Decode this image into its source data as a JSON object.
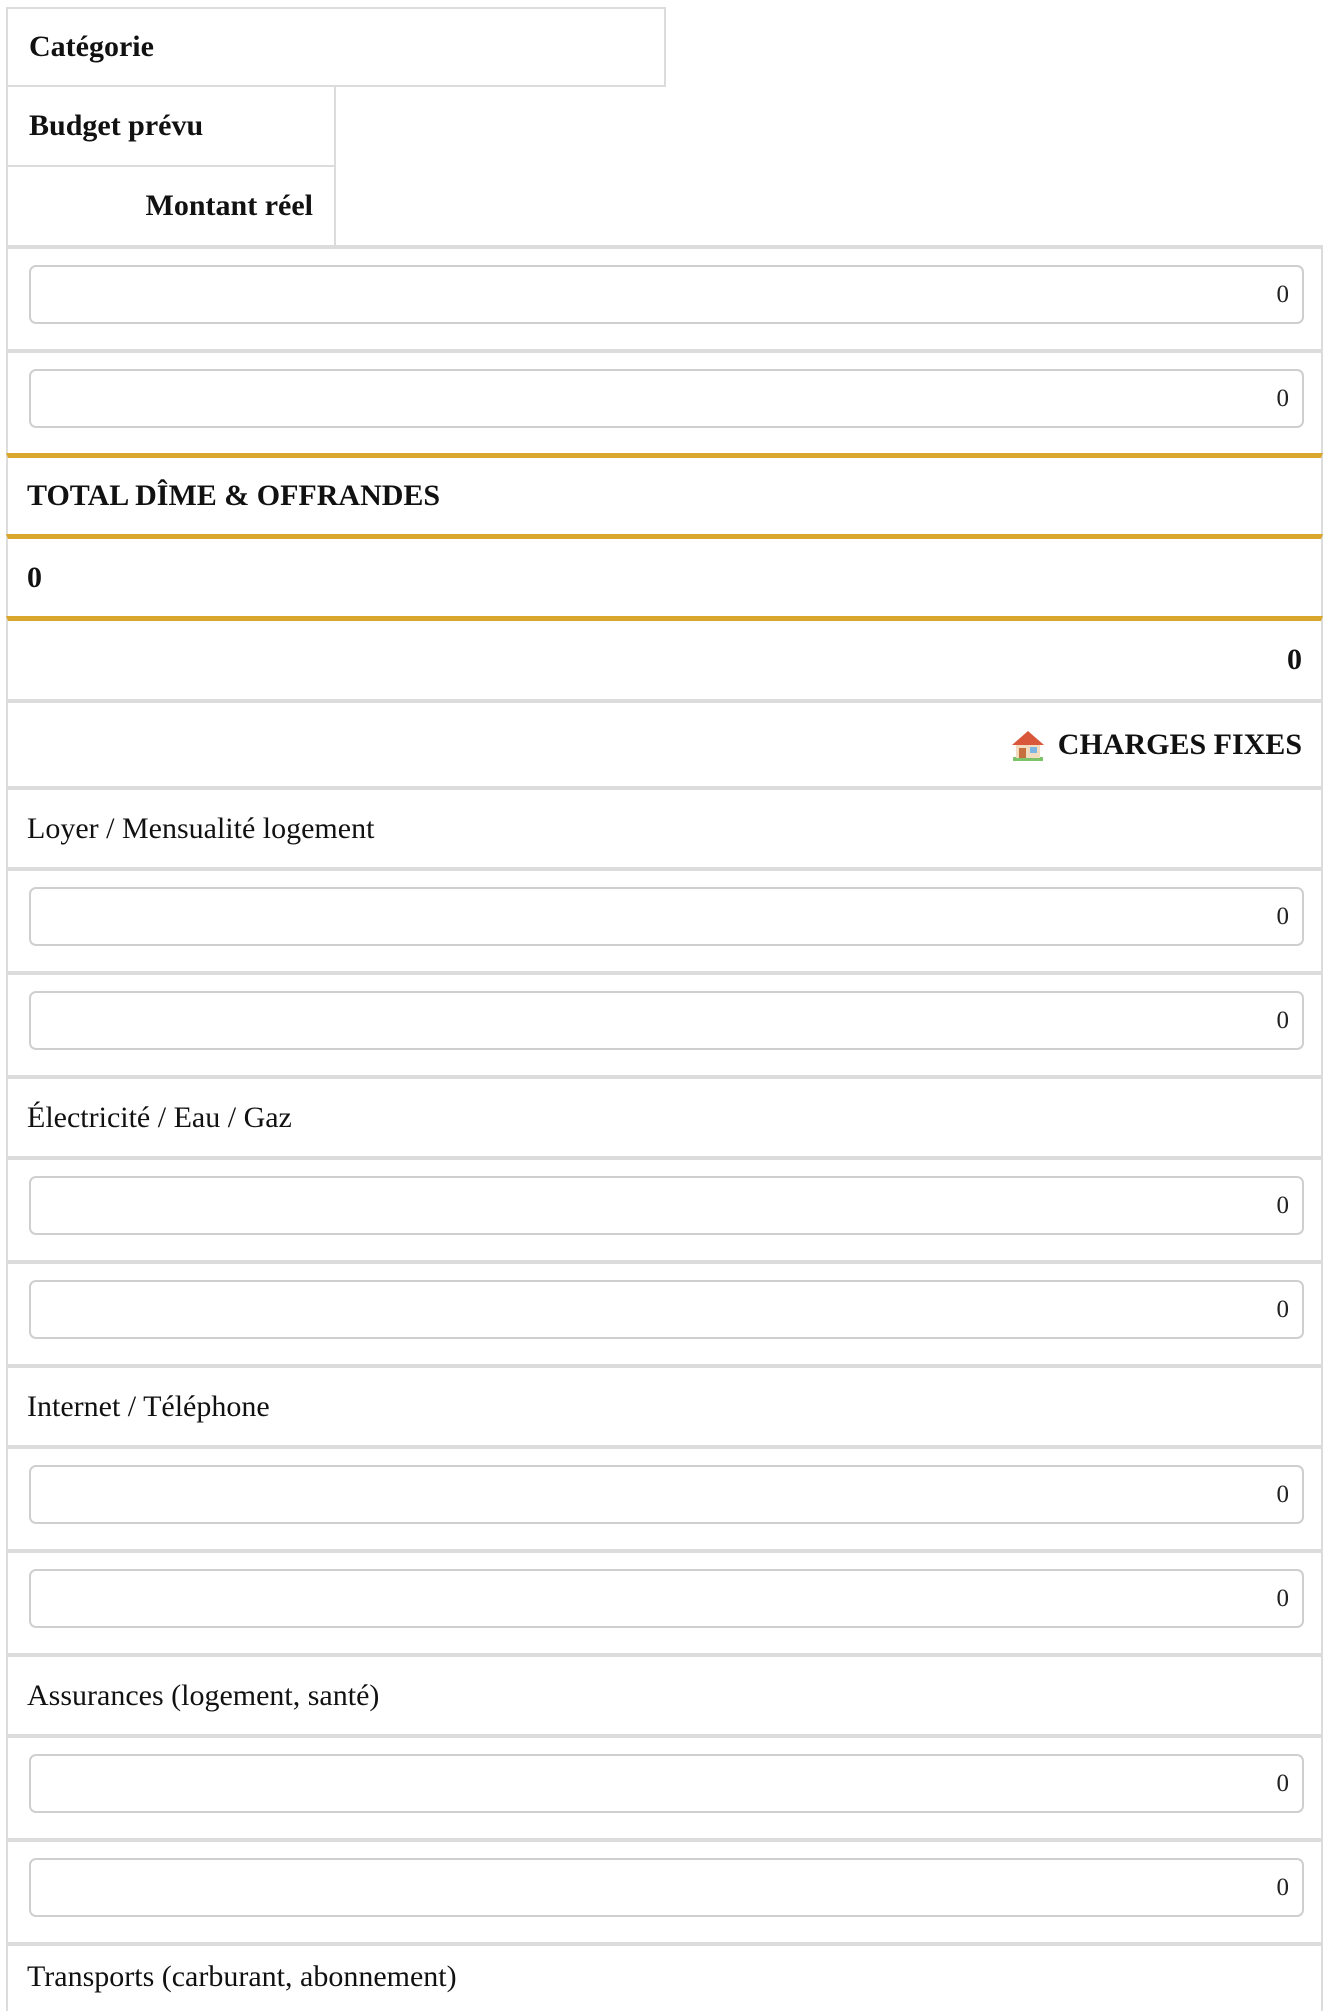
{
  "table": {
    "headers": {
      "category": "Catégorie",
      "planned": "Budget prévu",
      "actual": "Montant réel"
    },
    "tithe_inputs": {
      "planned": "0",
      "actual": "0"
    },
    "total_tithe": {
      "label": "TOTAL DÎME & OFFRANDES",
      "planned": "0",
      "actual": "0"
    },
    "fixed_section": {
      "icon": "house-icon",
      "title": "CHARGES FIXES"
    },
    "rows": [
      {
        "label": "Loyer / Mensualité logement",
        "planned": "0",
        "actual": "0"
      },
      {
        "label": "Électricité / Eau / Gaz",
        "planned": "0",
        "actual": "0"
      },
      {
        "label": "Internet / Téléphone",
        "planned": "0",
        "actual": "0"
      },
      {
        "label": "Assurances (logement, santé)",
        "planned": "0",
        "actual": "0"
      },
      {
        "label": "Transports (carburant, abonnement)"
      }
    ],
    "colors": {
      "total_border": "#d9a72c",
      "grid": "#dcdcdc"
    }
  }
}
